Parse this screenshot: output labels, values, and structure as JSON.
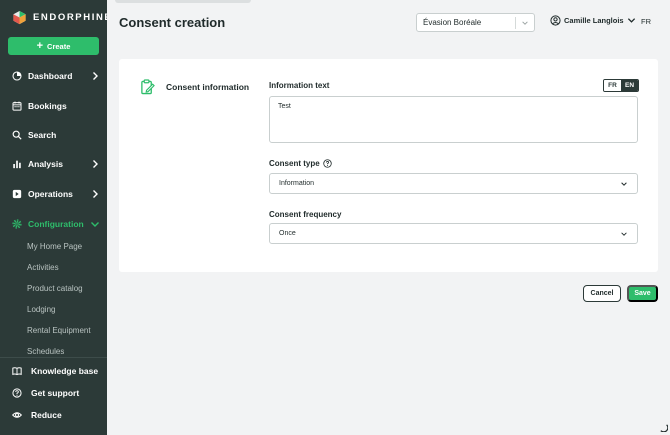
{
  "brand": {
    "name": "ENDORPHINE"
  },
  "sidebar": {
    "create_label": "Create",
    "items": [
      {
        "label": "Dashboard",
        "icon": "dashboard-icon",
        "chevron": "right"
      },
      {
        "label": "Bookings",
        "icon": "calendar-icon"
      },
      {
        "label": "Search",
        "icon": "search-icon"
      },
      {
        "label": "Analysis",
        "icon": "bar-chart-icon",
        "chevron": "right"
      },
      {
        "label": "Operations",
        "icon": "operations-icon",
        "chevron": "right"
      },
      {
        "label": "Configuration",
        "icon": "gear-icon",
        "chevron": "down",
        "active": true
      }
    ],
    "subitems": [
      "My Home Page",
      "Activities",
      "Product catalog",
      "Lodging",
      "Rental Equipment",
      "Schedules"
    ],
    "bottom": [
      {
        "label": "Knowledge base",
        "icon": "book-icon"
      },
      {
        "label": "Get support",
        "icon": "help-circle-icon"
      },
      {
        "label": "Reduce",
        "icon": "eye-icon"
      }
    ]
  },
  "header": {
    "title": "Consent creation",
    "company_select_value": "Évasion Boréale",
    "user_name": "Camille Langlois",
    "language": "FR"
  },
  "form": {
    "section_title": "Consent information",
    "info_text_label": "Information text",
    "lang_options": [
      "FR",
      "EN"
    ],
    "lang_active": "EN",
    "info_text_value": "Test",
    "consent_type_label": "Consent type",
    "consent_type_value": "Information",
    "consent_frequency_label": "Consent frequency",
    "consent_frequency_value": "Once"
  },
  "actions": {
    "cancel_label": "Cancel",
    "save_label": "Save"
  },
  "colors": {
    "sidebar_bg": "#2c3a38",
    "accent": "#2ebd6b",
    "page_bg": "#f2f3f4"
  }
}
